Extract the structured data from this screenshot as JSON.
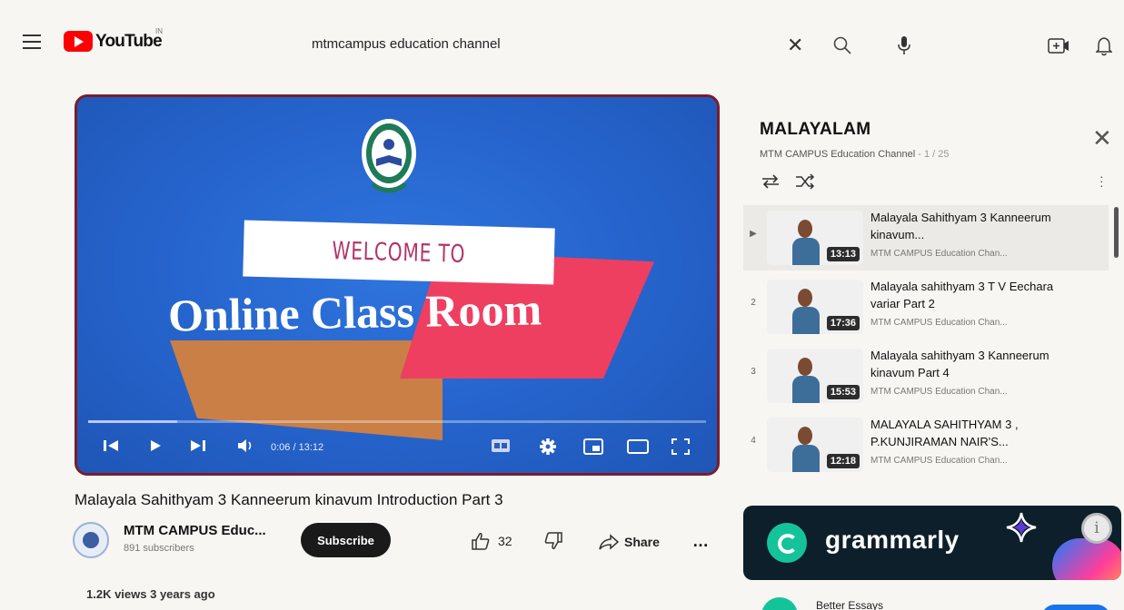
{
  "header": {
    "logo_text": "YouTube",
    "country_code": "IN",
    "search_query": "mtmcampus education channel"
  },
  "player": {
    "welcome_text": "WELCOME TO",
    "headline_text": "Online Class Room",
    "time_display": "0:06 / 13:12",
    "progress_percent": 0.8,
    "accent_color": "#2563cb"
  },
  "video": {
    "title": "Malayala Sahithyam 3 Kanneerum kinavum Introduction Part 3",
    "channel_name": "MTM CAMPUS Educ...",
    "subscribers": "891 subscribers",
    "subscribe_label": "Subscribe",
    "like_count": "32",
    "share_label": "Share",
    "more_label": "…",
    "views_age": "1.2K views  3 years ago"
  },
  "playlist": {
    "title": "MALAYALAM",
    "channel": "MTM CAMPUS Education Channel",
    "position": " - 1 / 25",
    "items": [
      {
        "index": "▶",
        "title": "Malayala Sahithyam 3 Kanneerum kinavum...",
        "channel": "MTM CAMPUS Education Chan...",
        "duration": "13:13"
      },
      {
        "index": "2",
        "title": "Malayala sahithyam 3 T V Eechara variar Part 2",
        "channel": "MTM CAMPUS Education Chan...",
        "duration": "17:36"
      },
      {
        "index": "3",
        "title": "Malayala sahithyam 3 Kanneerum kinavum Part 4",
        "channel": "MTM CAMPUS Education Chan...",
        "duration": "15:53"
      },
      {
        "index": "4",
        "title": "MALAYALA SAHITHYAM 3 , P.KUNJIRAMAN NAIR'S...",
        "channel": "MTM CAMPUS Education Chan...",
        "duration": "12:18"
      }
    ]
  },
  "ad": {
    "brand": "grammarly",
    "info_icon_label": "i",
    "brand_color": "#15c39a"
  },
  "next_section": {
    "title": "Better Essays"
  }
}
